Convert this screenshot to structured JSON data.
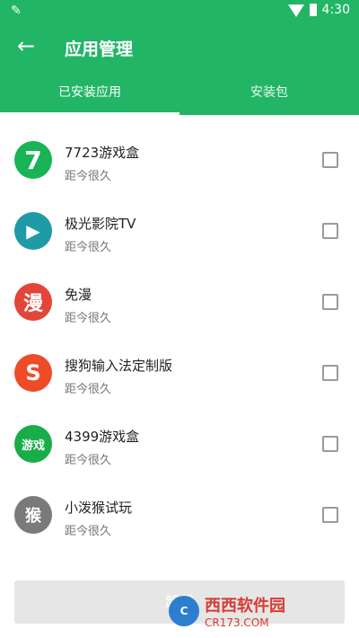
{
  "statusbar": {
    "time": "4:30",
    "left_icon": "pencil-icon",
    "wifi_icon": "wifi-icon",
    "battery_icon": "battery-icon"
  },
  "toolbar": {
    "back_icon": "arrow-left-icon",
    "title": "应用管理"
  },
  "tabs": [
    {
      "label": "已安装应用"
    },
    {
      "label": "安装包"
    }
  ],
  "apps": [
    {
      "name": "7723游戏盒",
      "time": "距今很久",
      "icon": "7723-icon",
      "icon_glyph": "7",
      "color": "#18b455"
    },
    {
      "name": "极光影院TV",
      "time": "距今很久",
      "icon": "jiguang-icon",
      "icon_glyph": "▶",
      "color": "#1e9ba6"
    },
    {
      "name": "免漫",
      "time": "距今很久",
      "icon": "mianman-icon",
      "icon_glyph": "漫",
      "color": "#e34638"
    },
    {
      "name": "搜狗输入法定制版",
      "time": "距今很久",
      "icon": "sogou-icon",
      "icon_glyph": "S",
      "color": "#ef4b28"
    },
    {
      "name": "4399游戏盒",
      "time": "距今很久",
      "icon": "4399-icon",
      "icon_glyph": "游戏",
      "color": "#19ad4a"
    },
    {
      "name": "小泼猴试玩",
      "time": "距今很久",
      "icon": "monkey-icon",
      "icon_glyph": "猴",
      "color": "#7a7a7a"
    }
  ],
  "bottom": {
    "uninstall_label": "卸载"
  },
  "watermark": {
    "logo": "C",
    "text": "西西软件园",
    "site": "CR173.COM"
  }
}
